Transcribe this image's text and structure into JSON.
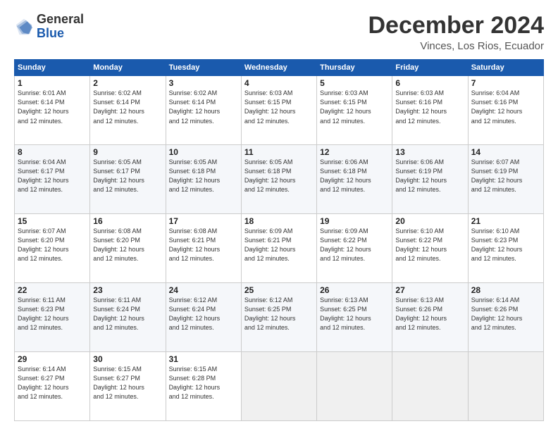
{
  "logo": {
    "general": "General",
    "blue": "Blue"
  },
  "title": "December 2024",
  "location": "Vinces, Los Rios, Ecuador",
  "days_of_week": [
    "Sunday",
    "Monday",
    "Tuesday",
    "Wednesday",
    "Thursday",
    "Friday",
    "Saturday"
  ],
  "weeks": [
    [
      {
        "day": "1",
        "info": "Sunrise: 6:01 AM\nSunset: 6:14 PM\nDaylight: 12 hours\nand 12 minutes."
      },
      {
        "day": "2",
        "info": "Sunrise: 6:02 AM\nSunset: 6:14 PM\nDaylight: 12 hours\nand 12 minutes."
      },
      {
        "day": "3",
        "info": "Sunrise: 6:02 AM\nSunset: 6:14 PM\nDaylight: 12 hours\nand 12 minutes."
      },
      {
        "day": "4",
        "info": "Sunrise: 6:03 AM\nSunset: 6:15 PM\nDaylight: 12 hours\nand 12 minutes."
      },
      {
        "day": "5",
        "info": "Sunrise: 6:03 AM\nSunset: 6:15 PM\nDaylight: 12 hours\nand 12 minutes."
      },
      {
        "day": "6",
        "info": "Sunrise: 6:03 AM\nSunset: 6:16 PM\nDaylight: 12 hours\nand 12 minutes."
      },
      {
        "day": "7",
        "info": "Sunrise: 6:04 AM\nSunset: 6:16 PM\nDaylight: 12 hours\nand 12 minutes."
      }
    ],
    [
      {
        "day": "8",
        "info": "Sunrise: 6:04 AM\nSunset: 6:17 PM\nDaylight: 12 hours\nand 12 minutes."
      },
      {
        "day": "9",
        "info": "Sunrise: 6:05 AM\nSunset: 6:17 PM\nDaylight: 12 hours\nand 12 minutes."
      },
      {
        "day": "10",
        "info": "Sunrise: 6:05 AM\nSunset: 6:18 PM\nDaylight: 12 hours\nand 12 minutes."
      },
      {
        "day": "11",
        "info": "Sunrise: 6:05 AM\nSunset: 6:18 PM\nDaylight: 12 hours\nand 12 minutes."
      },
      {
        "day": "12",
        "info": "Sunrise: 6:06 AM\nSunset: 6:18 PM\nDaylight: 12 hours\nand 12 minutes."
      },
      {
        "day": "13",
        "info": "Sunrise: 6:06 AM\nSunset: 6:19 PM\nDaylight: 12 hours\nand 12 minutes."
      },
      {
        "day": "14",
        "info": "Sunrise: 6:07 AM\nSunset: 6:19 PM\nDaylight: 12 hours\nand 12 minutes."
      }
    ],
    [
      {
        "day": "15",
        "info": "Sunrise: 6:07 AM\nSunset: 6:20 PM\nDaylight: 12 hours\nand 12 minutes."
      },
      {
        "day": "16",
        "info": "Sunrise: 6:08 AM\nSunset: 6:20 PM\nDaylight: 12 hours\nand 12 minutes."
      },
      {
        "day": "17",
        "info": "Sunrise: 6:08 AM\nSunset: 6:21 PM\nDaylight: 12 hours\nand 12 minutes."
      },
      {
        "day": "18",
        "info": "Sunrise: 6:09 AM\nSunset: 6:21 PM\nDaylight: 12 hours\nand 12 minutes."
      },
      {
        "day": "19",
        "info": "Sunrise: 6:09 AM\nSunset: 6:22 PM\nDaylight: 12 hours\nand 12 minutes."
      },
      {
        "day": "20",
        "info": "Sunrise: 6:10 AM\nSunset: 6:22 PM\nDaylight: 12 hours\nand 12 minutes."
      },
      {
        "day": "21",
        "info": "Sunrise: 6:10 AM\nSunset: 6:23 PM\nDaylight: 12 hours\nand 12 minutes."
      }
    ],
    [
      {
        "day": "22",
        "info": "Sunrise: 6:11 AM\nSunset: 6:23 PM\nDaylight: 12 hours\nand 12 minutes."
      },
      {
        "day": "23",
        "info": "Sunrise: 6:11 AM\nSunset: 6:24 PM\nDaylight: 12 hours\nand 12 minutes."
      },
      {
        "day": "24",
        "info": "Sunrise: 6:12 AM\nSunset: 6:24 PM\nDaylight: 12 hours\nand 12 minutes."
      },
      {
        "day": "25",
        "info": "Sunrise: 6:12 AM\nSunset: 6:25 PM\nDaylight: 12 hours\nand 12 minutes."
      },
      {
        "day": "26",
        "info": "Sunrise: 6:13 AM\nSunset: 6:25 PM\nDaylight: 12 hours\nand 12 minutes."
      },
      {
        "day": "27",
        "info": "Sunrise: 6:13 AM\nSunset: 6:26 PM\nDaylight: 12 hours\nand 12 minutes."
      },
      {
        "day": "28",
        "info": "Sunrise: 6:14 AM\nSunset: 6:26 PM\nDaylight: 12 hours\nand 12 minutes."
      }
    ],
    [
      {
        "day": "29",
        "info": "Sunrise: 6:14 AM\nSunset: 6:27 PM\nDaylight: 12 hours\nand 12 minutes."
      },
      {
        "day": "30",
        "info": "Sunrise: 6:15 AM\nSunset: 6:27 PM\nDaylight: 12 hours\nand 12 minutes."
      },
      {
        "day": "31",
        "info": "Sunrise: 6:15 AM\nSunset: 6:28 PM\nDaylight: 12 hours\nand 12 minutes."
      },
      {
        "day": "",
        "info": ""
      },
      {
        "day": "",
        "info": ""
      },
      {
        "day": "",
        "info": ""
      },
      {
        "day": "",
        "info": ""
      }
    ]
  ]
}
